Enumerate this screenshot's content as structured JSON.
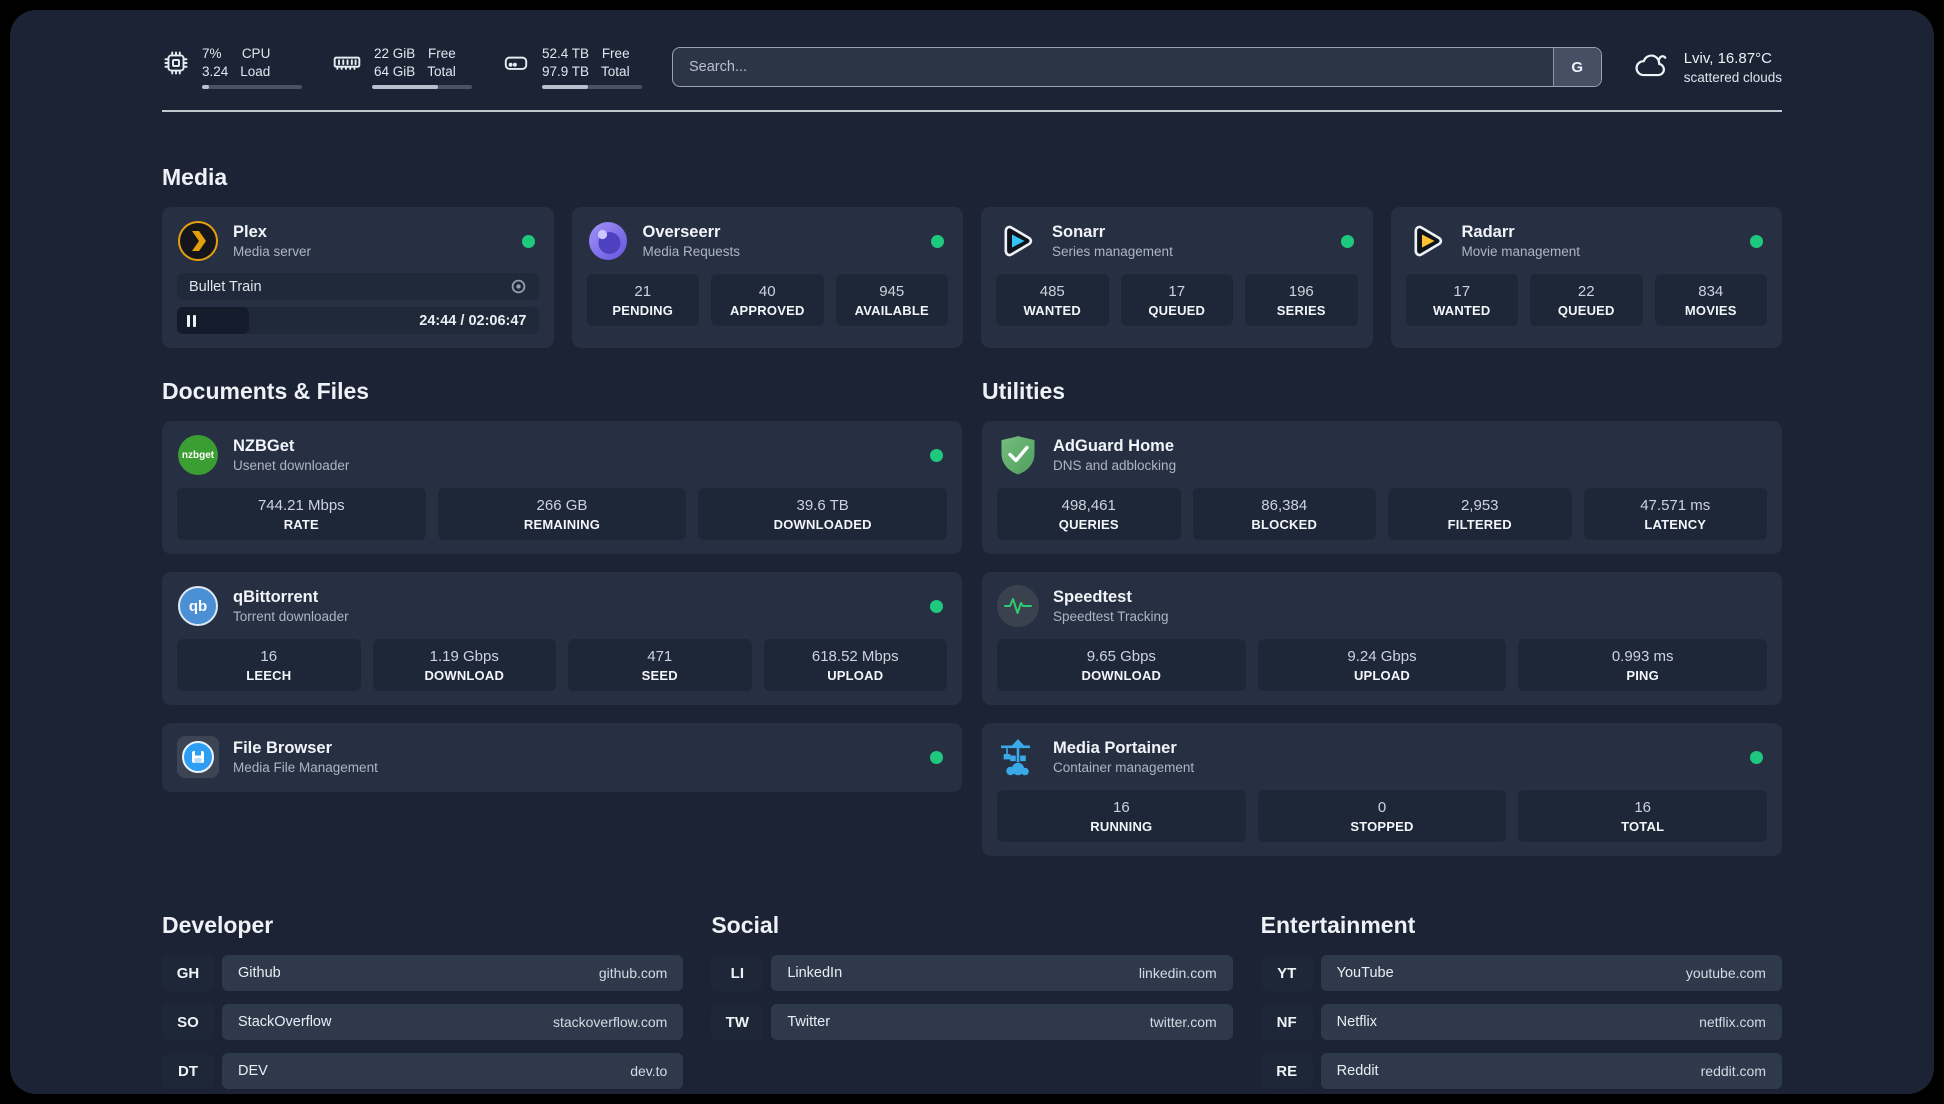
{
  "colors": {
    "online_green": "#1ec97e",
    "plex_gold": "#e5a00d",
    "sonarr_blue": "#35c5f4",
    "radarr_orange": "#ffc230",
    "nzbget_green": "#3b9e33",
    "qbittorrent_blue": "#4b8fd4",
    "filebrowser_blue": "#2e9ef4",
    "adguard_green": "#67b279",
    "portainer_blue": "#3aa9e9"
  },
  "header": {
    "system_stats": [
      {
        "id": "cpu",
        "icon": "cpu-icon",
        "value_top": "7%",
        "value_bottom": "3.24",
        "label_top": "CPU",
        "label_bottom": "Load",
        "progress": 7
      },
      {
        "id": "ram",
        "icon": "ram-icon",
        "value_top": "22 GiB",
        "value_bottom": "64 GiB",
        "label_top": "Free",
        "label_bottom": "Total",
        "progress": 66
      },
      {
        "id": "disk",
        "icon": "disk-icon",
        "value_top": "52.4 TB",
        "value_bottom": "97.9 TB",
        "label_top": "Free",
        "label_bottom": "Total",
        "progress": 46
      }
    ],
    "search": {
      "placeholder": "Search...",
      "button_label": "G"
    },
    "weather": {
      "icon": "cloud-icon",
      "location_temp": "Lviv, 16.87°C",
      "condition": "scattered clouds"
    }
  },
  "sections": {
    "media": {
      "title": "Media",
      "apps": [
        {
          "name": "Plex",
          "subtitle": "Media server",
          "icon": "plex",
          "online": true,
          "player": {
            "title": "Bullet Train",
            "time": "24:44 / 02:06:47",
            "progress_percent": 20,
            "state": "paused"
          }
        },
        {
          "name": "Overseerr",
          "subtitle": "Media Requests",
          "icon": "overseerr",
          "online": true,
          "stats": [
            {
              "value": "21",
              "label": "PENDING"
            },
            {
              "value": "40",
              "label": "APPROVED"
            },
            {
              "value": "945",
              "label": "AVAILABLE"
            }
          ]
        },
        {
          "name": "Sonarr",
          "subtitle": "Series management",
          "icon": "sonarr",
          "online": true,
          "stats": [
            {
              "value": "485",
              "label": "WANTED"
            },
            {
              "value": "17",
              "label": "QUEUED"
            },
            {
              "value": "196",
              "label": "SERIES"
            }
          ]
        },
        {
          "name": "Radarr",
          "subtitle": "Movie management",
          "icon": "radarr",
          "online": true,
          "stats": [
            {
              "value": "17",
              "label": "WANTED"
            },
            {
              "value": "22",
              "label": "QUEUED"
            },
            {
              "value": "834",
              "label": "MOVIES"
            }
          ]
        }
      ]
    },
    "documents": {
      "title": "Documents & Files",
      "apps": [
        {
          "name": "NZBGet",
          "subtitle": "Usenet downloader",
          "icon": "nzbget",
          "online": true,
          "stats": [
            {
              "value": "744.21 Mbps",
              "label": "RATE"
            },
            {
              "value": "266 GB",
              "label": "REMAINING"
            },
            {
              "value": "39.6 TB",
              "label": "DOWNLOADED"
            }
          ]
        },
        {
          "name": "qBittorrent",
          "subtitle": "Torrent downloader",
          "icon": "qbittorrent",
          "online": true,
          "stats": [
            {
              "value": "16",
              "label": "LEECH"
            },
            {
              "value": "1.19 Gbps",
              "label": "DOWNLOAD"
            },
            {
              "value": "471",
              "label": "SEED"
            },
            {
              "value": "618.52 Mbps",
              "label": "UPLOAD"
            }
          ]
        },
        {
          "name": "File Browser",
          "subtitle": "Media File Management",
          "icon": "filebrowser",
          "online": true,
          "stats": []
        }
      ]
    },
    "utilities": {
      "title": "Utilities",
      "apps": [
        {
          "name": "AdGuard Home",
          "subtitle": "DNS and adblocking",
          "icon": "adguard",
          "online": false,
          "stats": [
            {
              "value": "498,461",
              "label": "QUERIES"
            },
            {
              "value": "86,384",
              "label": "BLOCKED"
            },
            {
              "value": "2,953",
              "label": "FILTERED"
            },
            {
              "value": "47.571 ms",
              "label": "LATENCY"
            }
          ]
        },
        {
          "name": "Speedtest",
          "subtitle": "Speedtest Tracking",
          "icon": "speedtest",
          "online": false,
          "stats": [
            {
              "value": "9.65 Gbps",
              "label": "DOWNLOAD"
            },
            {
              "value": "9.24 Gbps",
              "label": "UPLOAD"
            },
            {
              "value": "0.993 ms",
              "label": "PING"
            }
          ]
        },
        {
          "name": "Media Portainer",
          "subtitle": "Container management",
          "icon": "portainer",
          "online": true,
          "stats": [
            {
              "value": "16",
              "label": "RUNNING"
            },
            {
              "value": "0",
              "label": "STOPPED"
            },
            {
              "value": "16",
              "label": "TOTAL"
            }
          ]
        }
      ]
    },
    "links": [
      {
        "title": "Developer",
        "items": [
          {
            "abbr": "GH",
            "name": "Github",
            "url": "github.com"
          },
          {
            "abbr": "SO",
            "name": "StackOverflow",
            "url": "stackoverflow.com"
          },
          {
            "abbr": "DT",
            "name": "DEV",
            "url": "dev.to"
          }
        ]
      },
      {
        "title": "Social",
        "items": [
          {
            "abbr": "LI",
            "name": "LinkedIn",
            "url": "linkedin.com"
          },
          {
            "abbr": "TW",
            "name": "Twitter",
            "url": "twitter.com"
          }
        ]
      },
      {
        "title": "Entertainment",
        "items": [
          {
            "abbr": "YT",
            "name": "YouTube",
            "url": "youtube.com"
          },
          {
            "abbr": "NF",
            "name": "Netflix",
            "url": "netflix.com"
          },
          {
            "abbr": "RE",
            "name": "Reddit",
            "url": "reddit.com"
          }
        ]
      }
    ]
  }
}
